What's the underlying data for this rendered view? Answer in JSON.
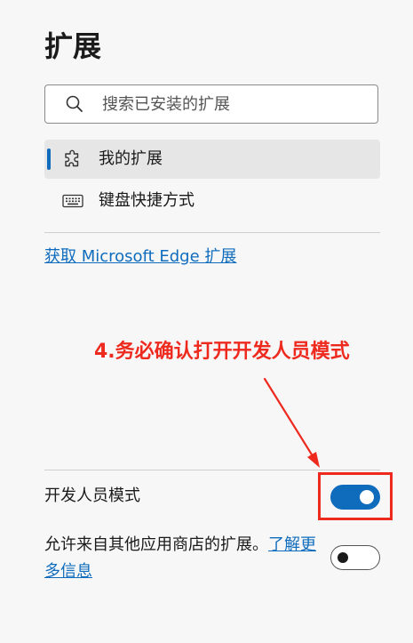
{
  "page": {
    "title": "扩展"
  },
  "search": {
    "placeholder": "搜索已安装的扩展",
    "value": "",
    "icon": "search-icon"
  },
  "nav": {
    "items": [
      {
        "label": "我的扩展",
        "icon": "puzzle-piece-icon",
        "active": true
      },
      {
        "label": "键盘快捷方式",
        "icon": "keyboard-icon",
        "active": false
      }
    ]
  },
  "store_link": {
    "label": "获取 Microsoft Edge 扩展"
  },
  "annotation": {
    "text": "4.务必确认打开开发人员模式",
    "color": "#ee2a1f"
  },
  "settings": {
    "developer_mode": {
      "label": "开发人员模式",
      "enabled": true
    },
    "other_stores": {
      "label": "允许来自其他应用商店的扩展。",
      "link_label": "了解更多信息",
      "enabled": false
    }
  },
  "colors": {
    "accent": "#0f6cbd",
    "background": "#f7f7f7",
    "annotation": "#ee2a1f"
  }
}
